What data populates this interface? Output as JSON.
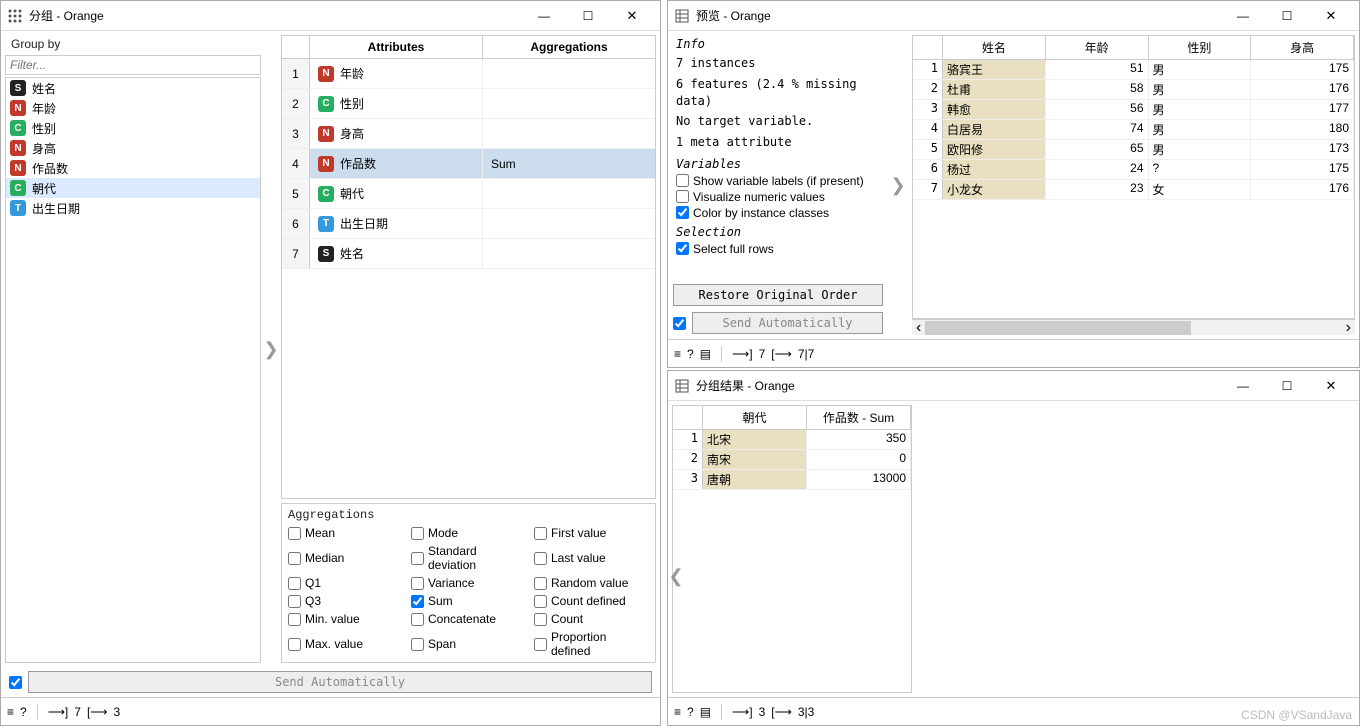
{
  "groupby_window": {
    "title": "分组 - Orange",
    "groupby_label": "Group by",
    "filter_placeholder": "Filter...",
    "vars": [
      {
        "type": "S",
        "name": "姓名"
      },
      {
        "type": "N",
        "name": "年龄"
      },
      {
        "type": "C",
        "name": "性别"
      },
      {
        "type": "N",
        "name": "身高"
      },
      {
        "type": "N",
        "name": "作品数"
      },
      {
        "type": "C",
        "name": "朝代"
      },
      {
        "type": "T",
        "name": "出生日期"
      }
    ],
    "selected_var_index": 5,
    "attr_table": {
      "col_attributes": "Attributes",
      "col_aggregations": "Aggregations",
      "rows": [
        {
          "idx": "1",
          "type": "N",
          "name": "年龄",
          "agg": ""
        },
        {
          "idx": "2",
          "type": "C",
          "name": "性别",
          "agg": ""
        },
        {
          "idx": "3",
          "type": "N",
          "name": "身高",
          "agg": ""
        },
        {
          "idx": "4",
          "type": "N",
          "name": "作品数",
          "agg": "Sum"
        },
        {
          "idx": "5",
          "type": "C",
          "name": "朝代",
          "agg": ""
        },
        {
          "idx": "6",
          "type": "T",
          "name": "出生日期",
          "agg": ""
        },
        {
          "idx": "7",
          "type": "S",
          "name": "姓名",
          "agg": ""
        }
      ],
      "selected_row_index": 3
    },
    "aggregations": {
      "label": "Aggregations",
      "items": [
        {
          "label": "Mean",
          "checked": false
        },
        {
          "label": "Mode",
          "checked": false
        },
        {
          "label": "First value",
          "checked": false
        },
        {
          "label": "Median",
          "checked": false
        },
        {
          "label": "Standard deviation",
          "checked": false
        },
        {
          "label": "Last value",
          "checked": false
        },
        {
          "label": "Q1",
          "checked": false
        },
        {
          "label": "Variance",
          "checked": false
        },
        {
          "label": "Random value",
          "checked": false
        },
        {
          "label": "Q3",
          "checked": false
        },
        {
          "label": "Sum",
          "checked": true
        },
        {
          "label": "Count defined",
          "checked": false
        },
        {
          "label": "Min. value",
          "checked": false
        },
        {
          "label": "Concatenate",
          "checked": false
        },
        {
          "label": "Count",
          "checked": false
        },
        {
          "label": "Max. value",
          "checked": false
        },
        {
          "label": "Span",
          "checked": false
        },
        {
          "label": "Proportion defined",
          "checked": false
        }
      ]
    },
    "send_auto": "Send Automatically",
    "status_in": "7",
    "status_out": "3"
  },
  "preview_window": {
    "title": "预览 - Orange",
    "info_label": "Info",
    "info_lines": {
      "l1": "7 instances",
      "l2": "6  features (2.4 % missing data)",
      "l3": "No target variable.",
      "l4": "1 meta attribute"
    },
    "variables_label": "Variables",
    "cb_show_labels": "Show variable labels (if present)",
    "cb_visualize": "Visualize numeric values",
    "cb_color": "Color by instance classes",
    "selection_label": "Selection",
    "cb_select_full": "Select full rows",
    "restore_btn": "Restore Original Order",
    "send_auto": "Send Automatically",
    "table": {
      "cols": [
        "姓名",
        "年龄",
        "性别",
        "身高"
      ],
      "rows": [
        {
          "idx": "1",
          "name": "骆宾王",
          "age": "51",
          "sex": "男",
          "height": "175"
        },
        {
          "idx": "2",
          "name": "杜甫",
          "age": "58",
          "sex": "男",
          "height": "176"
        },
        {
          "idx": "3",
          "name": "韩愈",
          "age": "56",
          "sex": "男",
          "height": "177"
        },
        {
          "idx": "4",
          "name": "白居易",
          "age": "74",
          "sex": "男",
          "height": "180"
        },
        {
          "idx": "5",
          "name": "欧阳修",
          "age": "65",
          "sex": "男",
          "height": "173"
        },
        {
          "idx": "6",
          "name": "杨过",
          "age": "24",
          "sex": "?",
          "height": "175"
        },
        {
          "idx": "7",
          "name": "小龙女",
          "age": "23",
          "sex": "女",
          "height": "176"
        }
      ]
    },
    "status_in": "7",
    "status_out": "7|7"
  },
  "result_window": {
    "title": "分组结果 - Orange",
    "table": {
      "cols": [
        "朝代",
        "作品数 - Sum"
      ],
      "rows": [
        {
          "idx": "1",
          "dyn": "北宋",
          "sum": "350"
        },
        {
          "idx": "2",
          "dyn": "南宋",
          "sum": "0"
        },
        {
          "idx": "3",
          "dyn": "唐朝",
          "sum": "13000"
        }
      ]
    },
    "status_in": "3",
    "status_out": "3|3"
  },
  "watermark": "CSDN @VSandJava"
}
